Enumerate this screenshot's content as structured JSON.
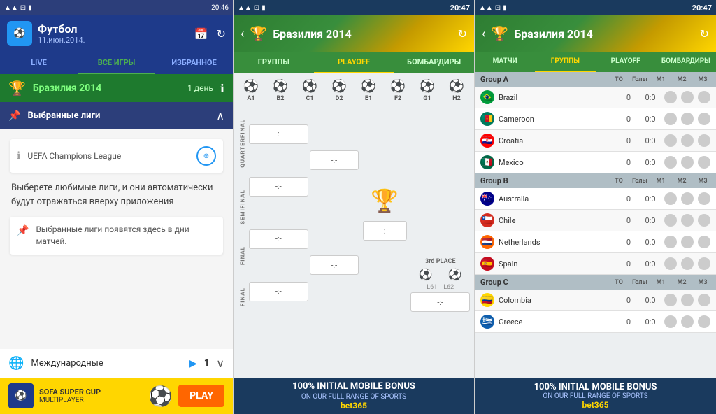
{
  "app": {
    "title": "Футбол",
    "subtitle": "11.июн.2014.",
    "time1": "20:46",
    "time2": "20:47",
    "time3": "20:47"
  },
  "panel1": {
    "tabs": [
      "LIVE",
      "ВСЕ ИГРЫ",
      "ИЗБРАННОЕ"
    ],
    "active_tab": 1,
    "league_banner": {
      "name": "Бразилия 2014",
      "day": "1 день"
    },
    "fav_header": "Выбранные лиги",
    "league_item": "UEFA Champions League",
    "description": "Выберете любимые лиги, и они автоматически будут отражаться вверху приложения",
    "tip": "Выбранные лиги появятся здесь в дни матчей.",
    "international": "Международные",
    "intl_count": "1",
    "footer": {
      "line1": "SOFA SUPER CUP",
      "line2": "MULTIPLAYER",
      "play": "PLAY"
    }
  },
  "panel2": {
    "title": "Бразилия 2014",
    "tabs": [
      "ГРУППЫ",
      "PLAYOFF",
      "БОМБАРДИРЫ"
    ],
    "active_tab": 1,
    "seeds": [
      "A1",
      "B2",
      "C1",
      "D2",
      "E1",
      "F2",
      "G1",
      "H2"
    ],
    "stages": [
      "QUARTERFINAL",
      "SEMIFINAL",
      "FINAL",
      "FINAL"
    ],
    "matches": {
      "qf": [
        "-:-",
        "-:-"
      ],
      "sf": "-:-",
      "final": "-:-",
      "third": "-:-"
    },
    "ad": {
      "line1": "100% INITIAL MOBILE BONUS",
      "line2": "ON OUR FULL RANGE OF SPORTS",
      "brand": "bet365"
    }
  },
  "panel3": {
    "title": "Бразилия 2014",
    "tabs": [
      "МАТЧИ",
      "ГРУППЫ",
      "PLAYOFF",
      "БОМБАРДИРЫ"
    ],
    "active_tab": 1,
    "groups": [
      {
        "name": "Group A",
        "cols": [
          "ТО",
          "Голы",
          "М1",
          "М2",
          "М3"
        ],
        "teams": [
          {
            "name": "Brazil",
            "flag": "🇧🇷",
            "flag_class": "flag-brazil",
            "to": "0",
            "goals": "0:0"
          },
          {
            "name": "Cameroon",
            "flag": "🇨🇲",
            "flag_class": "flag-cameroon",
            "to": "0",
            "goals": "0:0"
          },
          {
            "name": "Croatia",
            "flag": "🇭🇷",
            "flag_class": "flag-croatia",
            "to": "0",
            "goals": "0:0"
          },
          {
            "name": "Mexico",
            "flag": "🇲🇽",
            "flag_class": "flag-mexico",
            "to": "0",
            "goals": "0:0"
          }
        ]
      },
      {
        "name": "Group B",
        "cols": [
          "ТО",
          "Голы",
          "М1",
          "М2",
          "М3"
        ],
        "teams": [
          {
            "name": "Australia",
            "flag": "🇦🇺",
            "flag_class": "flag-australia",
            "to": "0",
            "goals": "0:0"
          },
          {
            "name": "Chile",
            "flag": "🇨🇱",
            "flag_class": "flag-chile",
            "to": "0",
            "goals": "0:0"
          },
          {
            "name": "Netherlands",
            "flag": "🇳🇱",
            "flag_class": "flag-netherlands",
            "to": "0",
            "goals": "0:0"
          },
          {
            "name": "Spain",
            "flag": "🇪🇸",
            "flag_class": "flag-spain",
            "to": "0",
            "goals": "0:0"
          }
        ]
      },
      {
        "name": "Group C",
        "cols": [
          "ТО",
          "Голы",
          "М1",
          "М2",
          "М3"
        ],
        "teams": [
          {
            "name": "Colombia",
            "flag": "🇨🇴",
            "flag_class": "flag-colombia",
            "to": "0",
            "goals": "0:0"
          },
          {
            "name": "Greece",
            "flag": "🇬🇷",
            "flag_class": "flag-greece",
            "to": "0",
            "goals": "0:0"
          }
        ]
      }
    ],
    "ad": {
      "line1": "100% INITIAL MOBILE BONUS",
      "line2": "ON OUR FULL RANGE OF SPORTS",
      "brand": "bet365"
    }
  }
}
